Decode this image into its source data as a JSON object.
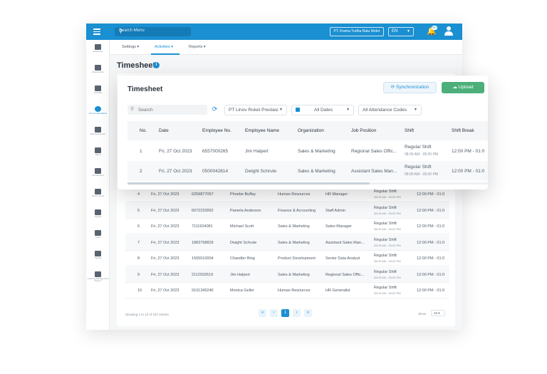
{
  "topbar": {
    "search_placeholder": "Search Menu",
    "company": "PT. Krama Yudha Ratu Motor",
    "language": "EN",
    "notification_count": "99+"
  },
  "sidebar": {
    "items": [
      {
        "label": "Employee"
      },
      {
        "label": "Organization"
      },
      {
        "label": "Activities"
      },
      {
        "label": "Time & Attendance"
      },
      {
        "label": "Reimbursement"
      },
      {
        "label": "Talent"
      },
      {
        "label": "Recruitment"
      },
      {
        "label": "Performance"
      },
      {
        "label": "Payroll"
      },
      {
        "label": "Loan"
      },
      {
        "label": "Training"
      },
      {
        "label": "Learning Management System"
      }
    ]
  },
  "subnav": {
    "tabs": [
      "Settings",
      "Activities",
      "Reports"
    ],
    "active": "Activities"
  },
  "page": {
    "title": "Timesheet"
  },
  "card": {
    "title": "Timesheet",
    "sync_label": "Synchronization",
    "upload_label": "Upload",
    "search_placeholder": "Search",
    "company_filter": "PT Linov Roket Prestasi",
    "date_filter": "All Dates",
    "code_filter": "All Attendance Codes"
  },
  "table": {
    "headers": [
      "No.",
      "Date",
      "Employee No.",
      "Employee Name",
      "Organization",
      "Job Position",
      "Shift",
      "Shift Break"
    ],
    "front_rows": [
      {
        "no": "1",
        "date": "Fri, 27 Oct 2023",
        "emp_no": "6557000265",
        "name": "Jim Halpert",
        "org": "Sales & Marketing",
        "job": "Regional Sales Offic...",
        "shift": "Regular Shift",
        "time": "08:00 AM - 05:00 PM",
        "break": "12:00 PM - 01:0"
      },
      {
        "no": "2",
        "date": "Fri, 27 Oct 2023",
        "emp_no": "0500042814",
        "name": "Dwight Schrute",
        "org": "Sales & Marketing",
        "job": "Assistant Sales Man...",
        "shift": "Regular Shift",
        "time": "08:00 AM - 05:00 PM",
        "break": "12:00 PM - 01:0"
      }
    ],
    "back_rows": [
      {
        "no": "4",
        "date": "Fri, 27 Oct 2023",
        "emp_no": "6259877057",
        "name": "Phoebe Buffay",
        "org": "Human Resources",
        "job": "HR Manager",
        "shift": "Regular Shift",
        "time": "08:00 AM - 05:00 PM",
        "break": "12:00 PM - 01:0"
      },
      {
        "no": "5",
        "date": "Fri, 27 Oct 2023",
        "emp_no": "6072232892",
        "name": "Pamela Anderson",
        "org": "Finance & Accounting",
        "job": "Staff Admin",
        "shift": "Regular Shift",
        "time": "08:00 AM - 05:00 PM",
        "break": "12:00 PM - 01:0"
      },
      {
        "no": "6",
        "date": "Fri, 27 Oct 2023",
        "emp_no": "7111924081",
        "name": "Michael Scott",
        "org": "Sales & Marketing",
        "job": "Sales Manager",
        "shift": "Regular Shift",
        "time": "08:00 AM - 05:00 PM",
        "break": "12:00 PM - 01:0"
      },
      {
        "no": "7",
        "date": "Fri, 27 Oct 2023",
        "emp_no": "1883798829",
        "name": "Dwight Schrute",
        "org": "Sales & Marketing",
        "job": "Assistant Sales Man...",
        "shift": "Regular Shift",
        "time": "08:00 AM - 05:00 PM",
        "break": "12:00 PM - 01:0"
      },
      {
        "no": "8",
        "date": "Fri, 27 Oct 2023",
        "emp_no": "1565010004",
        "name": "Chandler Bing",
        "org": "Product Development",
        "job": "Senior Data Analyst",
        "shift": "Regular Shift",
        "time": "08:00 AM - 05:00 PM",
        "break": "12:00 PM - 01:0"
      },
      {
        "no": "9",
        "date": "Fri, 27 Oct 2023",
        "emp_no": "2112032619",
        "name": "Jim Halpert",
        "org": "Sales & Marketing",
        "job": "Regional Sales Offic...",
        "shift": "Regular Shift",
        "time": "08:00 AM - 05:00 PM",
        "break": "12:00 PM - 01:0"
      },
      {
        "no": "10",
        "date": "Fri, 27 Oct 2023",
        "emp_no": "9101345246",
        "name": "Monica Geller",
        "org": "Human Resources",
        "job": "HR Generalist",
        "shift": "Regular Shift",
        "time": "08:00 AM - 05:00 PM",
        "break": "12:00 PM - 01:0"
      }
    ],
    "footer": "Showing 1 to 10 of 107 entries",
    "current_page": "1",
    "show_label": "Show",
    "page_size": "10"
  },
  "colors": {
    "accent": "#1a8fd1",
    "upload": "#4caf7a"
  }
}
